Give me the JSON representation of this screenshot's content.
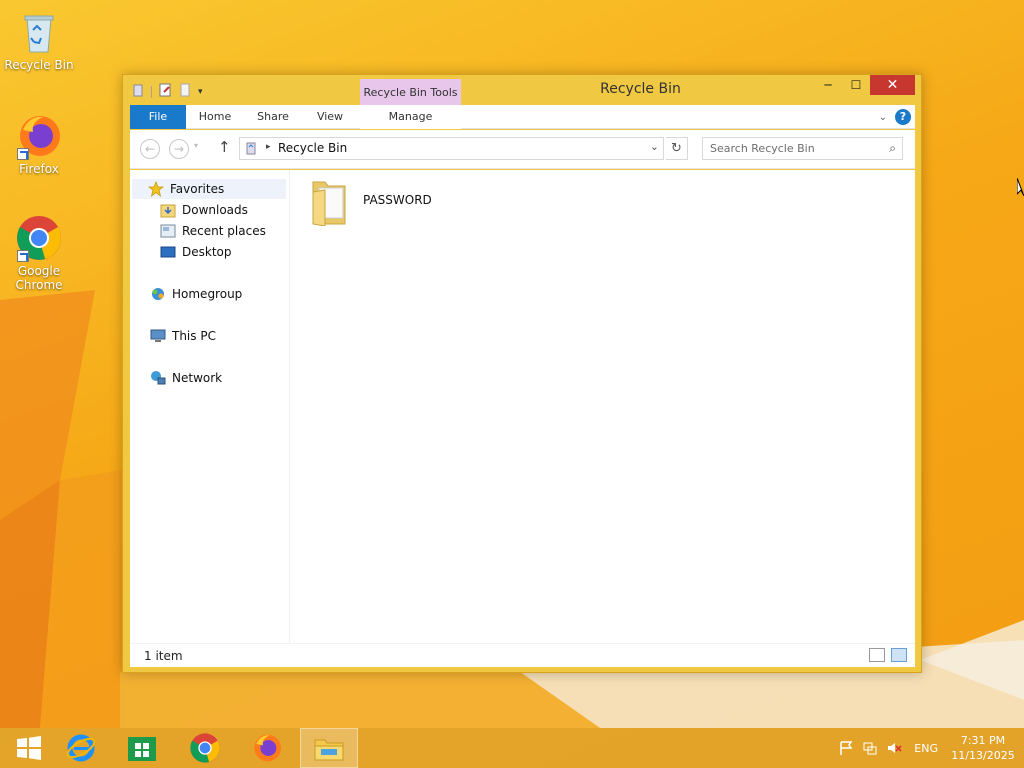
{
  "desktop": {
    "icons": [
      {
        "label": "Recycle Bin",
        "icon": "recycle-bin-icon"
      },
      {
        "label": "Firefox",
        "icon": "firefox-icon"
      },
      {
        "label": "Google Chrome",
        "icon": "chrome-icon"
      }
    ]
  },
  "window": {
    "title": "Recycle Bin",
    "contextual_tab_group": "Recycle Bin Tools",
    "ribbon_tabs": [
      "File",
      "Home",
      "Share",
      "View",
      "Manage"
    ],
    "address": {
      "crumb": "Recycle Bin"
    },
    "search": {
      "placeholder": "Search Recycle Bin"
    },
    "nav_pane": {
      "favorites": "Favorites",
      "favorites_children": [
        "Downloads",
        "Recent places",
        "Desktop"
      ],
      "homegroup": "Homegroup",
      "this_pc": "This PC",
      "network": "Network"
    },
    "files": [
      {
        "name": "PASSWORD",
        "type": "folder"
      }
    ],
    "status": {
      "item_count": "1 item"
    }
  },
  "taskbar": {
    "items": [
      "start-icon",
      "internet-explorer-icon",
      "store-icon",
      "chrome-icon",
      "firefox-icon",
      "file-explorer-icon"
    ],
    "language": "ENG",
    "time": "7:31 PM",
    "date": "11/13/2025"
  },
  "colors": {
    "accent": "#1979ca",
    "window_frame": "#f0c842",
    "close_button": "#c7372f",
    "contextual_tab": "#e8c6ec"
  }
}
